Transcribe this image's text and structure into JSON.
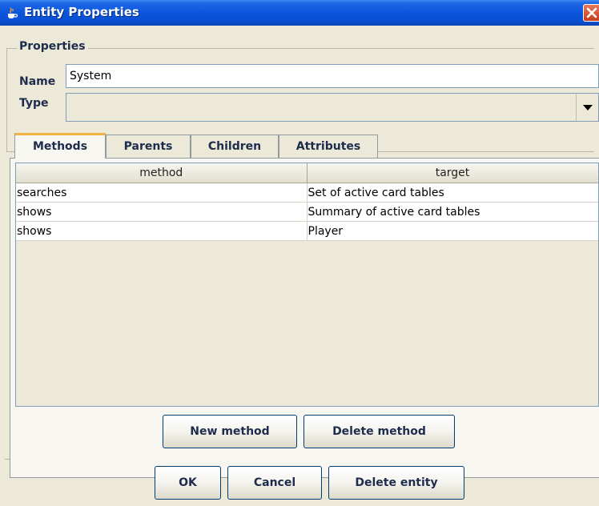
{
  "window": {
    "title": "Entity Properties",
    "icon": "java-cup-icon",
    "close_icon": "close-x-icon"
  },
  "properties": {
    "group_label": "Properties",
    "name_label": "Name",
    "name_value": "System",
    "type_label": "Type",
    "type_value": ""
  },
  "tabs": [
    {
      "label": "Methods",
      "selected": true
    },
    {
      "label": "Parents",
      "selected": false
    },
    {
      "label": "Children",
      "selected": false
    },
    {
      "label": "Attributes",
      "selected": false
    }
  ],
  "methods_table": {
    "columns": [
      "method",
      "target"
    ],
    "rows": [
      [
        "searches",
        "Set of active card tables"
      ],
      [
        "shows",
        "Summary of active card tables"
      ],
      [
        "shows",
        "Player"
      ]
    ]
  },
  "panel_buttons": {
    "new_method": "New method",
    "delete_method": "Delete method"
  },
  "dialog_buttons": {
    "ok": "OK",
    "cancel": "Cancel",
    "delete_entity": "Delete entity"
  },
  "colors": {
    "title_bar": "#0a55dc",
    "dialog_bg": "#ece9d8",
    "tab_highlight": "#f4b040",
    "close_button": "#c63d1a"
  }
}
